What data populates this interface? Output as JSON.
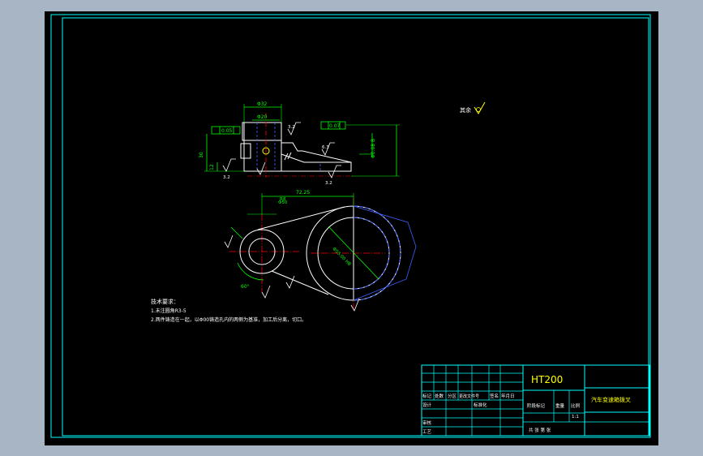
{
  "title_block": {
    "material": "HT200",
    "part_name": "汽车变速箱拨叉",
    "row_labels": [
      "标记",
      "处数",
      "分区",
      "更改文件号",
      "签名",
      "年月日"
    ],
    "designer_label": "设计",
    "standard_label": "标准化",
    "review_label": "审核",
    "process_label": "工艺",
    "stage_label": "阶段标记",
    "weight_label": "重量",
    "scale_label": "比例",
    "scale_value": "1:1",
    "sheet_text": "共    张    第    张"
  },
  "notes": {
    "title": "技术要求：",
    "line1": "1.未注圆角R3-5",
    "line2": "2.两件铸造在一起，以Φ00铸造孔内的两侧为基准，加工后分离，切口。"
  },
  "roughness": {
    "general_label": "其余",
    "values": [
      "3.2",
      "3.2",
      "6.3",
      "3.2",
      "12.5"
    ]
  },
  "dimensions": {
    "d32": "Φ32",
    "d20": "Φ20",
    "tol_flat": "0.05",
    "tol_perp": "0.07",
    "h30": "30",
    "h12": "12",
    "len": "72.25",
    "d50": "Φ50",
    "r": "R8",
    "angle": "60°",
    "top_note": "Φ0.08 B",
    "hole_note": "Φ55.00 H8"
  },
  "colors": {
    "background": "#000000",
    "frame": "#00ffff",
    "outline": "#ffffff",
    "dimension": "#00ff00",
    "centerline": "#ff0000",
    "hidden": "#4060ff",
    "annotation": "#ffff00"
  }
}
